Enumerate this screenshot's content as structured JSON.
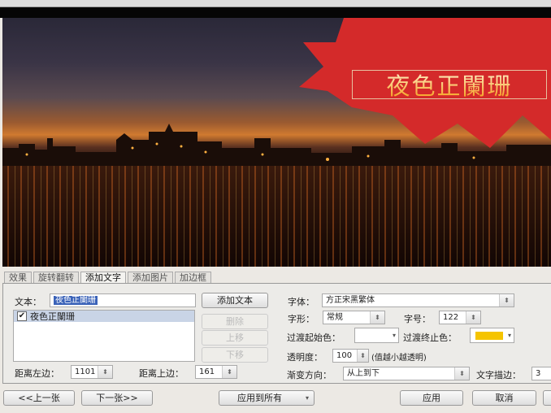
{
  "preview": {
    "overlay_text": "夜色正闌珊",
    "splash_color": "#d42a2a"
  },
  "tabs": [
    {
      "label": "效果"
    },
    {
      "label": "旋转翻转"
    },
    {
      "label": "添加文字",
      "active": true
    },
    {
      "label": "添加图片"
    },
    {
      "label": "加边框"
    }
  ],
  "text_panel": {
    "text_label": "文本：",
    "text_value": "夜色正闌珊",
    "add_text_button": "添加文本",
    "delete_button": "删除",
    "move_up_button": "上移",
    "move_down_button": "下移",
    "list_items": [
      {
        "label": "夜色正闌珊",
        "checked": true
      }
    ],
    "left_margin_label": "距离左边：",
    "left_margin_value": "1101",
    "top_margin_label": "距离上边：",
    "top_margin_value": "161"
  },
  "font_panel": {
    "font_label": "字体：",
    "font_value": "方正宋黑繁体",
    "style_label": "字形：",
    "style_value": "常规",
    "size_label": "字号：",
    "size_value": "122",
    "gradient_start_label": "过渡起始色：",
    "gradient_start_color": "#ffffff",
    "gradient_end_label": "过渡终止色：",
    "gradient_end_color": "#f5c400",
    "opacity_label": "透明度：",
    "opacity_value": "100",
    "opacity_hint": "(值越小越透明)",
    "gradient_dir_label": "渐变方向：",
    "gradient_dir_value": "从上到下",
    "stroke_label": "文字描边：",
    "stroke_value": "3"
  },
  "footer": {
    "prev_button": "<<上一张",
    "next_button": "下一张>>",
    "apply_all": "应用到所有",
    "apply_button": "应用",
    "cancel_button": "取消"
  }
}
